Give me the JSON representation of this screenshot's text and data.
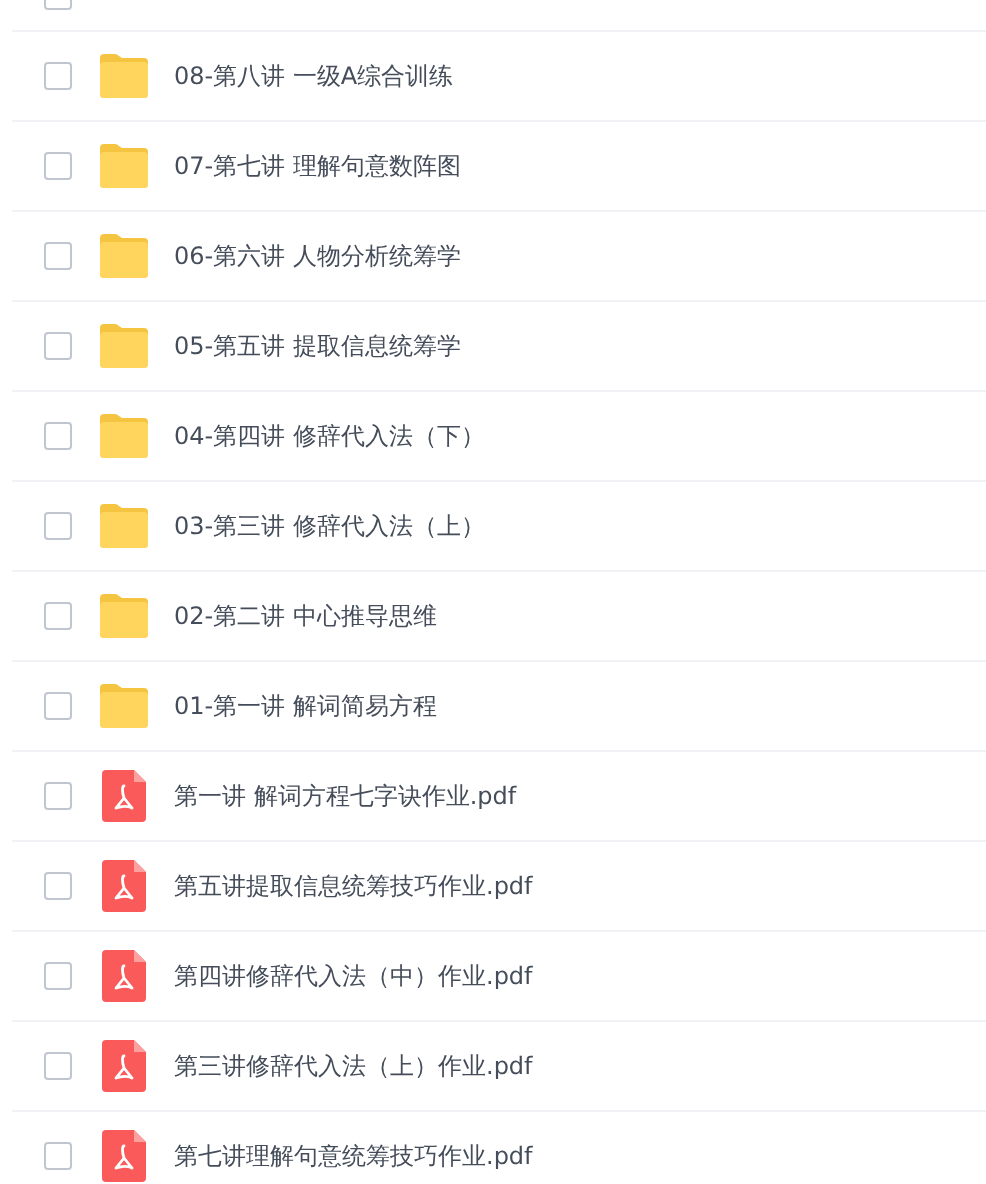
{
  "header": {
    "checked": false
  },
  "files": [
    {
      "kind": "folder",
      "name": "08-第八讲 一级A综合训练",
      "checked": false
    },
    {
      "kind": "folder",
      "name": "07-第七讲 理解句意数阵图",
      "checked": false
    },
    {
      "kind": "folder",
      "name": "06-第六讲 人物分析统筹学",
      "checked": false
    },
    {
      "kind": "folder",
      "name": "05-第五讲 提取信息统筹学",
      "checked": false
    },
    {
      "kind": "folder",
      "name": "04-第四讲 修辞代入法（下）",
      "checked": false
    },
    {
      "kind": "folder",
      "name": "03-第三讲 修辞代入法（上）",
      "checked": false
    },
    {
      "kind": "folder",
      "name": "02-第二讲 中心推导思维",
      "checked": false
    },
    {
      "kind": "folder",
      "name": "01-第一讲 解词简易方程",
      "checked": false
    },
    {
      "kind": "pdf",
      "name": "第一讲 解词方程七字诀作业.pdf",
      "checked": false
    },
    {
      "kind": "pdf",
      "name": "第五讲提取信息统筹技巧作业.pdf",
      "checked": false
    },
    {
      "kind": "pdf",
      "name": "第四讲修辞代入法（中）作业.pdf",
      "checked": false
    },
    {
      "kind": "pdf",
      "name": "第三讲修辞代入法（上）作业.pdf",
      "checked": false
    },
    {
      "kind": "pdf",
      "name": "第七讲理解句意统筹技巧作业.pdf",
      "checked": false
    }
  ]
}
